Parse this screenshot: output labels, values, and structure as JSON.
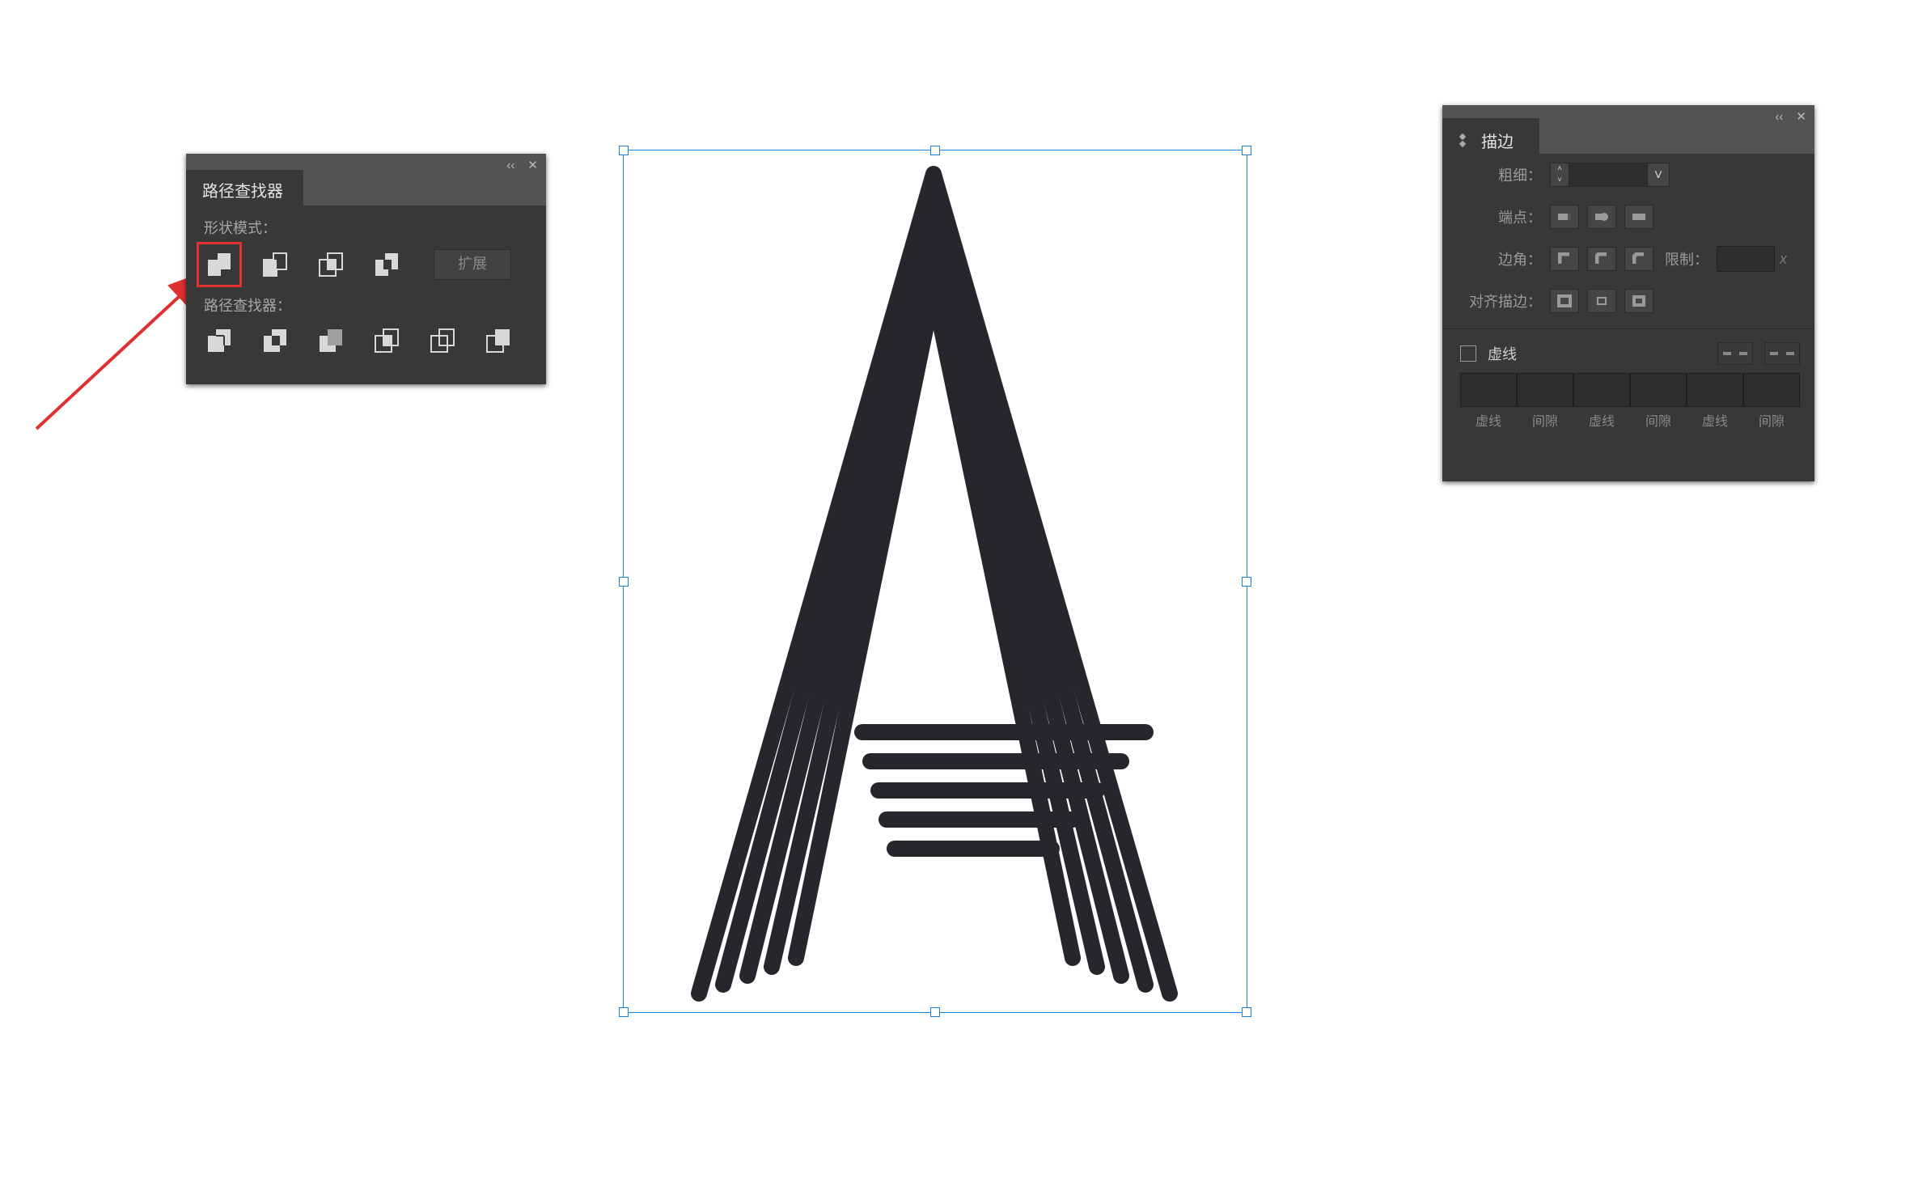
{
  "pathfinder": {
    "tab_title": "路径查找器",
    "section_shape_modes": "形状模式：",
    "section_pathfinders": "路径查找器：",
    "expand_label": "扩展",
    "shape_mode_icons": [
      "unite",
      "minus-front",
      "intersect",
      "exclude"
    ],
    "pathfinder_icons": [
      "divide",
      "trim",
      "merge",
      "crop",
      "outline",
      "minus-back"
    ],
    "selected_shape_mode": "unite"
  },
  "stroke": {
    "tab_title": "描边",
    "row_weight": "粗细：",
    "row_cap": "端点：",
    "row_corner": "边角：",
    "row_limit_label": "限制：",
    "row_limit_unit": "x",
    "row_align": "对齐描边：",
    "dash_checkbox_label": "虚线",
    "dash_labels": [
      "虚线",
      "间隙",
      "虚线",
      "间隙",
      "虚线",
      "间隙"
    ]
  },
  "artwork": {
    "selected": true
  }
}
